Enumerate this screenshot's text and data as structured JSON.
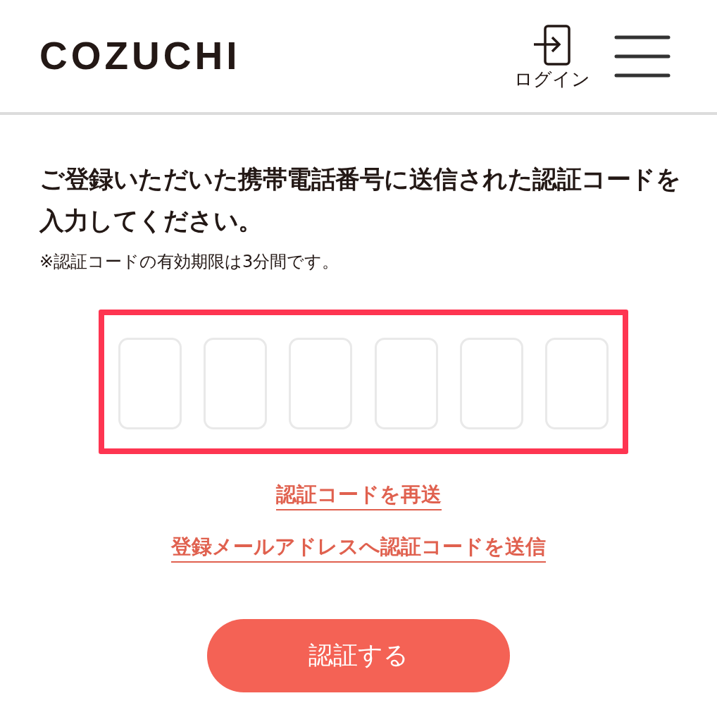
{
  "header": {
    "logo": "COZUCHI",
    "login_label": "ログイン"
  },
  "instructions": {
    "heading": "ご登録いただいた携帯電話番号に送信された認証コードを入力してください。",
    "note": "※認証コードの有効期限は3分間です。"
  },
  "code_entry": {
    "highlighted": true,
    "fields": [
      {
        "kind": "digit"
      },
      {
        "kind": "digit"
      },
      {
        "kind": "digit"
      },
      {
        "kind": "digit"
      },
      {
        "kind": "digit"
      },
      {
        "kind": "digit"
      }
    ]
  },
  "links": [
    "認証コードを再送",
    "登録メールアドレスへ認証コードを送信"
  ],
  "submit_button": "認証する"
}
